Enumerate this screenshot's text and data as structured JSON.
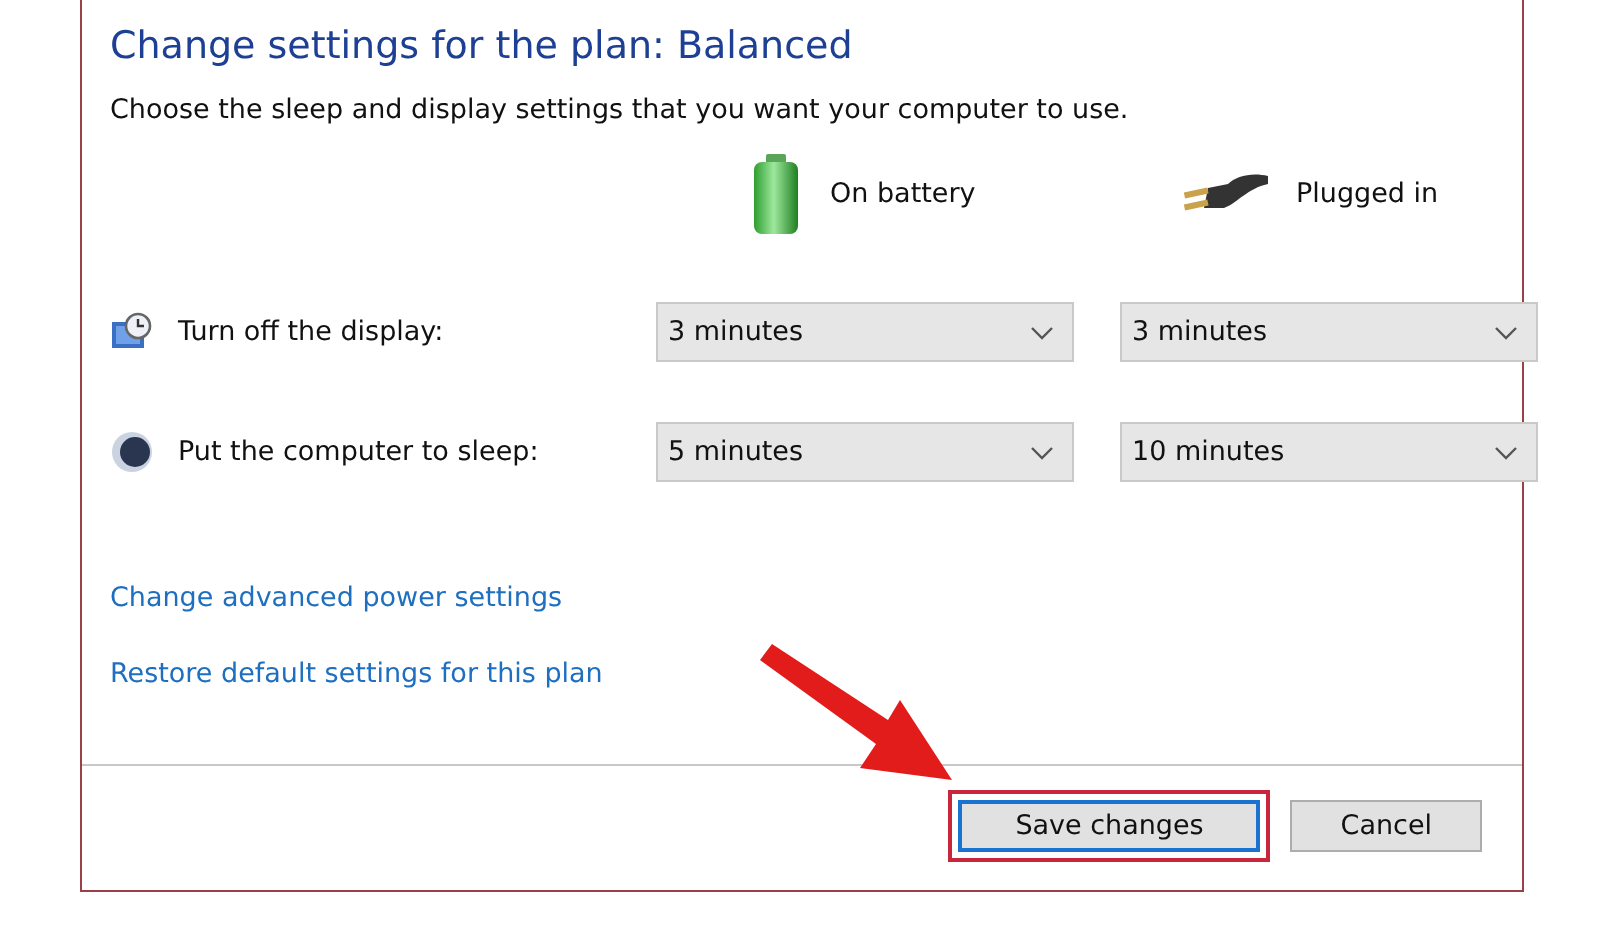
{
  "title": "Change settings for the plan: Balanced",
  "description": "Choose the sleep and display settings that you want your computer to use.",
  "columns": [
    {
      "kind": "battery",
      "label": "On battery"
    },
    {
      "kind": "plug",
      "label": "Plugged in"
    }
  ],
  "settings": [
    {
      "kind": "display",
      "label": "Turn off the display:",
      "values": [
        "3 minutes",
        "3 minutes"
      ]
    },
    {
      "kind": "sleep",
      "label": "Put the computer to sleep:",
      "values": [
        "5 minutes",
        "10 minutes"
      ]
    }
  ],
  "links": [
    "Change advanced power settings",
    "Restore default settings for this plan"
  ],
  "buttons": [
    {
      "label": "Save changes",
      "kind": "default",
      "highlighted": true
    },
    {
      "label": "Cancel",
      "kind": "normal",
      "highlighted": false
    }
  ]
}
